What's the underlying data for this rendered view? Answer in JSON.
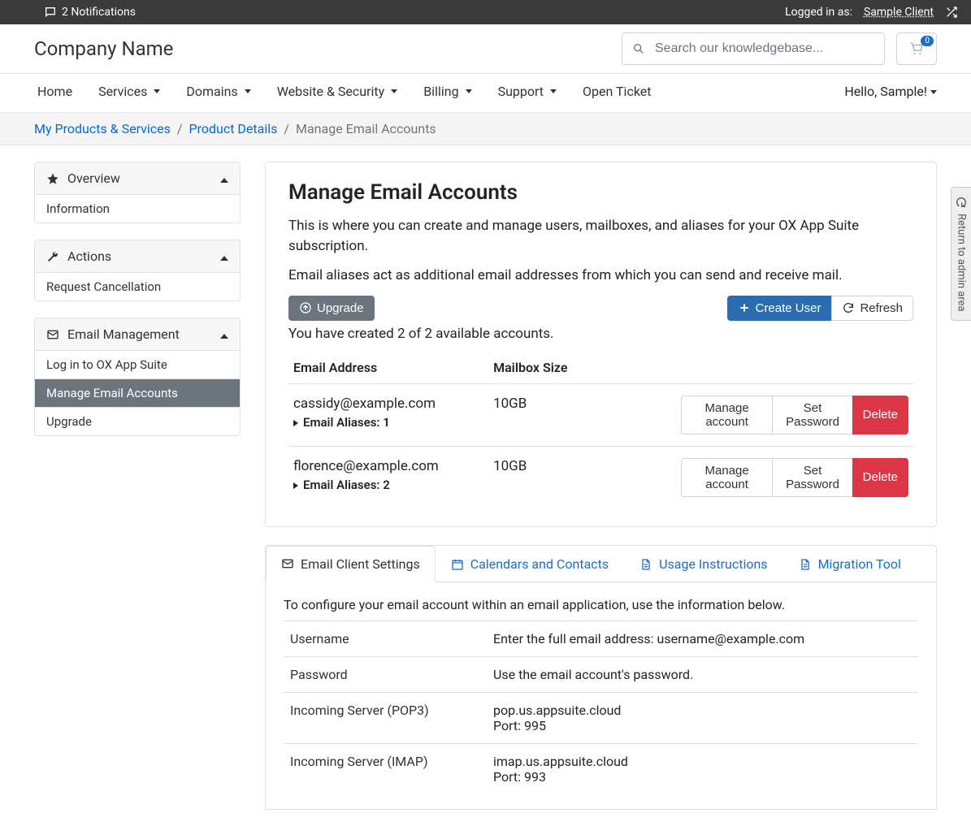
{
  "topbar": {
    "notifications": "2 Notifications",
    "logged_in_label": "Logged in as:",
    "client_name": "Sample Client"
  },
  "header": {
    "brand": "Company Name",
    "search_placeholder": "Search our knowledgebase...",
    "cart_count": "0"
  },
  "nav": {
    "items": [
      "Home",
      "Services",
      "Domains",
      "Website & Security",
      "Billing",
      "Support",
      "Open Ticket"
    ],
    "greeting": "Hello, Sample!"
  },
  "breadcrumb": {
    "a": "My Products & Services",
    "b": "Product Details",
    "c": "Manage Email Accounts"
  },
  "sidebar": {
    "overview": {
      "title": "Overview",
      "items": [
        "Information"
      ]
    },
    "actions": {
      "title": "Actions",
      "items": [
        "Request Cancellation"
      ]
    },
    "email": {
      "title": "Email Management",
      "items": [
        "Log in to OX App Suite",
        "Manage Email Accounts",
        "Upgrade"
      ],
      "active_index": 1
    }
  },
  "main": {
    "title": "Manage Email Accounts",
    "intro1": "This is where you can create and manage users, mailboxes, and aliases for your OX App Suite subscription.",
    "intro2": "Email aliases act as additional email addresses from which you can send and receive mail.",
    "upgrade_label": "Upgrade",
    "create_user_label": "Create User",
    "refresh_label": "Refresh",
    "status": "You have created 2 of 2 available accounts.",
    "columns": {
      "email": "Email Address",
      "size": "Mailbox Size"
    },
    "row_actions": {
      "manage": "Manage account",
      "setpw": "Set Password",
      "delete": "Delete"
    },
    "aliases_label": "Email Aliases:",
    "accounts": [
      {
        "email": "cassidy@example.com",
        "size": "10GB",
        "aliases": "1"
      },
      {
        "email": "florence@example.com",
        "size": "10GB",
        "aliases": "2"
      }
    ]
  },
  "tabs": {
    "items": [
      "Email Client Settings",
      "Calendars and Contacts",
      "Usage Instructions",
      "Migration Tool"
    ],
    "active_index": 0,
    "intro": "To configure your email account within an email application, use the information below.",
    "settings": [
      {
        "label": "Username",
        "value": "Enter the full email address: username@example.com"
      },
      {
        "label": "Password",
        "value": "Use the email account's password."
      },
      {
        "label": "Incoming Server (POP3)",
        "value": "pop.us.appsuite.cloud\nPort: 995"
      },
      {
        "label": "Incoming Server (IMAP)",
        "value": "imap.us.appsuite.cloud\nPort: 993"
      }
    ]
  },
  "admin_return": "Return to admin area"
}
